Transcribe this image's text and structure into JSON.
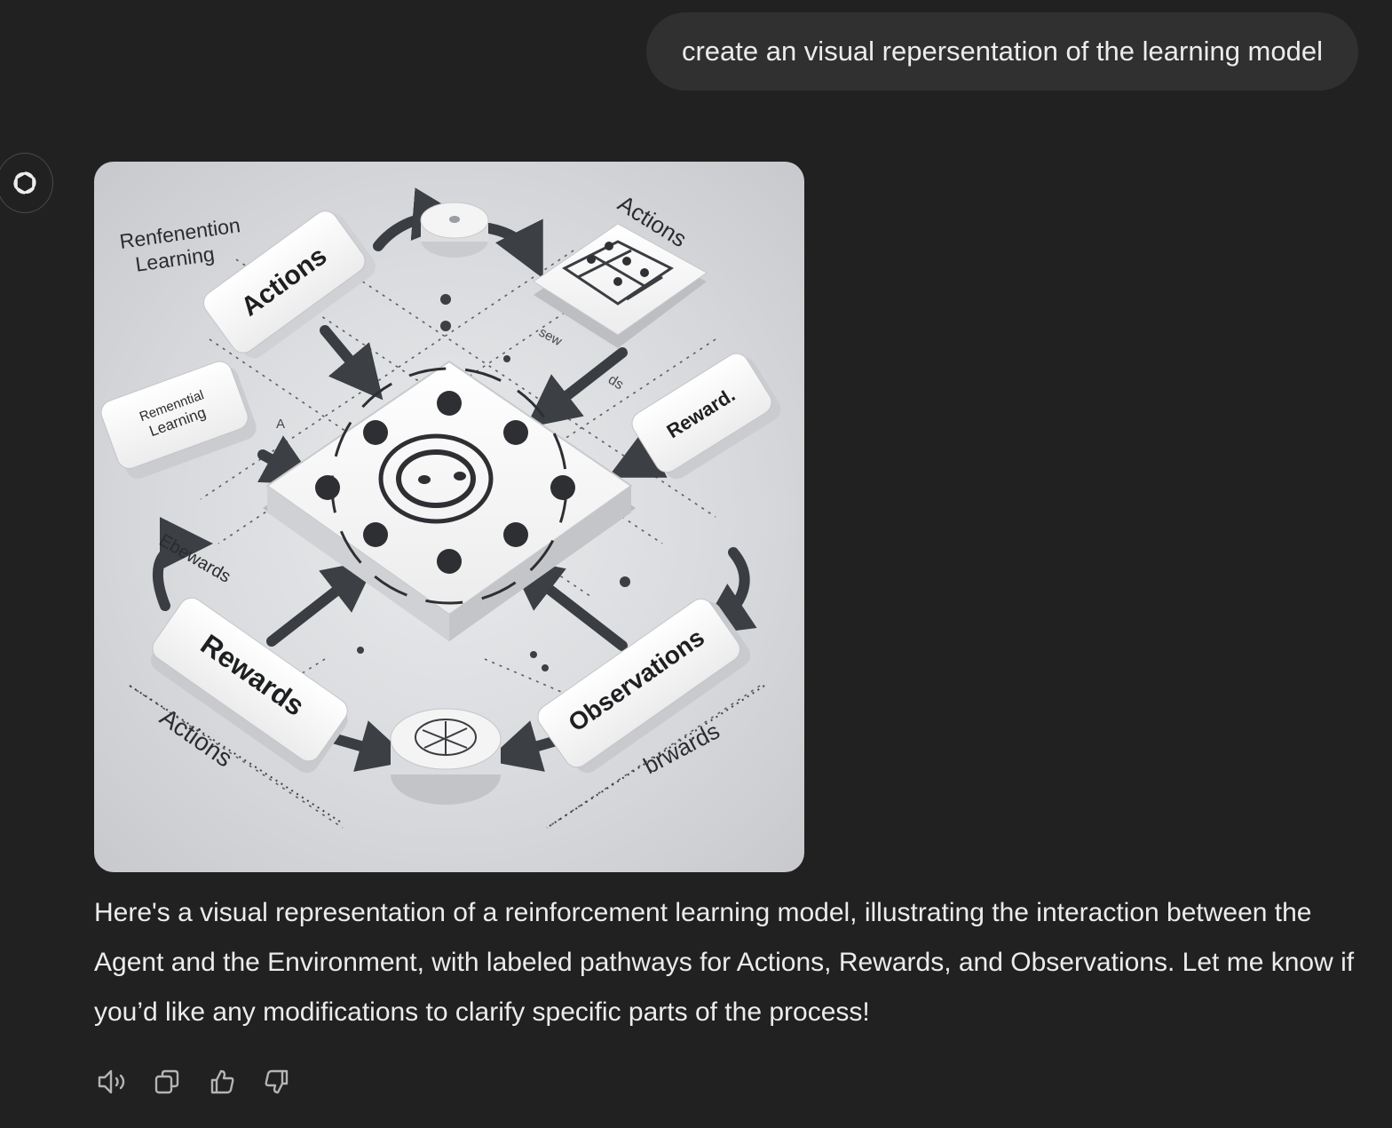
{
  "user_message": "create an visual repersentation of the learning model",
  "image": {
    "texts": {
      "title_line1": "Renfenention",
      "title_line2": "Learning",
      "actions_box": "Actions",
      "actions_top_right": "Actions",
      "left_box_line1": "Remenntial",
      "left_box_line2": "Learning",
      "reward_box": "Reward.",
      "rewards_box": "Rewards",
      "observations_box": "Observations",
      "actions_bottom_left": "Actions",
      "brwards_bottom_right": "brwards",
      "ebewards_left": "Ebewards",
      "sew_mid": "sew",
      "ds_mid": "ds",
      "a_mid": "A"
    }
  },
  "response": {
    "text": "Here's a visual representation of a reinforcement learning model, illustrating the interaction between the Agent and the Environment, with labeled pathways for Actions, Rewards, and Observations. Let me know if you’d like any modifications to clarify specific parts of the process!"
  },
  "action_icons": [
    "speaker-icon",
    "copy-icon",
    "thumbs-up-icon",
    "thumbs-down-icon"
  ],
  "colors": {
    "background": "#212121",
    "bubble": "#303030",
    "text": "#ececec",
    "icon": "#b4b4b4"
  }
}
